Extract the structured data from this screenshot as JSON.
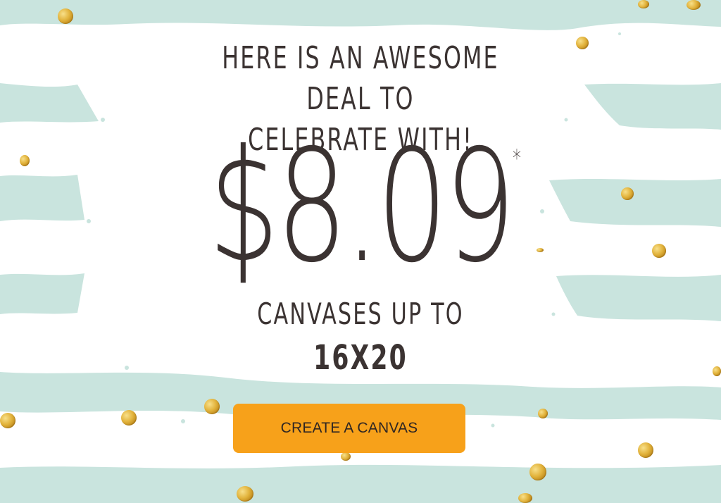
{
  "promo": {
    "headline_line1": "HERE IS AN AWESOME DEAL TO",
    "headline_line2": "CELEBRATE WITH!",
    "price": "$8.09",
    "price_asterisk": "*",
    "subline": "CANVASES UP TO",
    "size": "16X20",
    "cta_label": "CREATE A CANVAS"
  },
  "colors": {
    "stripe": "#c9e4de",
    "text": "#3b3332",
    "cta_background": "#f7a11a",
    "gold": "#e2b33c"
  }
}
